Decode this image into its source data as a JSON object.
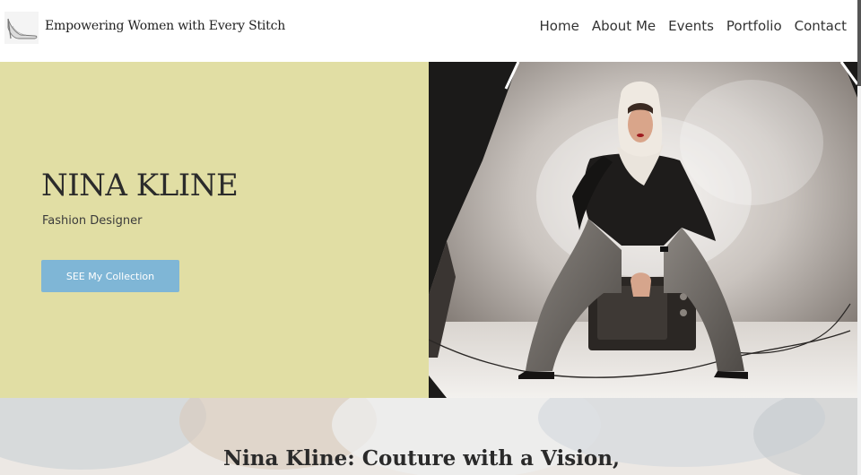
{
  "header": {
    "brand": "Empowering Women with Every Stitch",
    "logo_icon": "stiletto-shoe-icon",
    "nav": [
      "Home",
      "About Me",
      "Events",
      "Portfolio",
      "Contact"
    ]
  },
  "hero": {
    "name": "NINA KLINE",
    "role": "Fashion Designer",
    "cta_label": "SEE My Collection",
    "photo_alt": "Woman in headscarf seated on a vintage television in a photo studio",
    "colors": {
      "panel": "#e1dea4",
      "button": "#7fb6d6"
    }
  },
  "section": {
    "title": "Nina Kline: Couture with a Vision,"
  }
}
